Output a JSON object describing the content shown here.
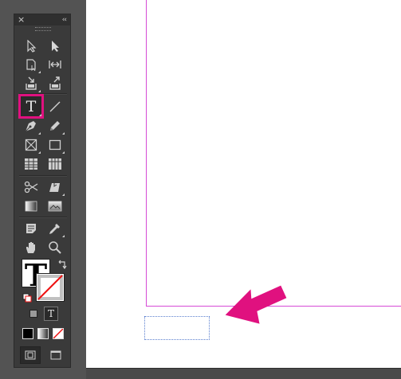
{
  "panel": {
    "close_glyph": "×",
    "collapse_glyph": "‹‹"
  },
  "tools": [
    {
      "name": "selection-tool",
      "icon": "arrow-outline-icon"
    },
    {
      "name": "direct-selection-tool",
      "icon": "arrow-filled-icon"
    },
    {
      "name": "page-tool",
      "icon": "page-icon"
    },
    {
      "name": "gap-tool",
      "icon": "gap-icon"
    },
    {
      "name": "content-collector-tool",
      "icon": "collector-icon"
    },
    {
      "name": "content-placer-tool",
      "icon": "placer-icon"
    },
    {
      "name": "type-tool",
      "icon": "type-icon",
      "glyph": "T",
      "selected": true
    },
    {
      "name": "line-tool",
      "icon": "line-icon"
    },
    {
      "name": "pen-tool",
      "icon": "pen-icon"
    },
    {
      "name": "pencil-tool",
      "icon": "pencil-icon"
    },
    {
      "name": "rectangle-frame-tool",
      "icon": "rectangle-frame-icon"
    },
    {
      "name": "rectangle-tool",
      "icon": "rectangle-icon"
    },
    {
      "name": "table-tool",
      "icon": "table-icon"
    },
    {
      "name": "grid-tool",
      "icon": "grid-icon"
    },
    {
      "name": "scissors-tool",
      "icon": "scissors-icon"
    },
    {
      "name": "free-transform-tool",
      "icon": "free-transform-icon"
    },
    {
      "name": "gradient-swatch-tool",
      "icon": "gradient-swatch-icon"
    },
    {
      "name": "gradient-feather-tool",
      "icon": "gradient-feather-icon"
    },
    {
      "name": "note-tool",
      "icon": "note-icon"
    },
    {
      "name": "eyedropper-tool",
      "icon": "eyedropper-icon"
    },
    {
      "name": "hand-tool",
      "icon": "hand-icon"
    },
    {
      "name": "zoom-tool",
      "icon": "zoom-icon"
    }
  ],
  "fill_stroke": {
    "fill_glyph": "T",
    "formatting_glyph": "T",
    "swap_icon": "swap-arrows-icon",
    "default_icon": "default-fill-stroke-icon"
  },
  "colors": {
    "panel_bg": "#3a3a3a",
    "selection_highlight": "#e0117f",
    "page_border": "#d64ad6",
    "frame_border": "#5a7fcf",
    "arrow": "#e0117f"
  }
}
